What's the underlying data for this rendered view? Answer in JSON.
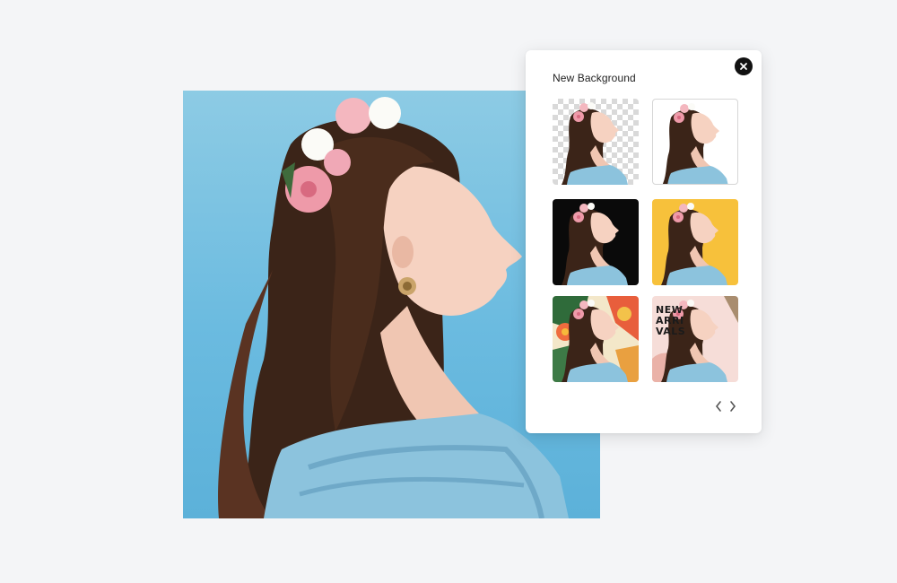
{
  "panel": {
    "title": "New Background",
    "close_icon": "close-icon",
    "backgrounds": [
      {
        "id": "transparent",
        "label": ""
      },
      {
        "id": "white",
        "label": ""
      },
      {
        "id": "black",
        "label": ""
      },
      {
        "id": "yellow",
        "label": ""
      },
      {
        "id": "floral",
        "label": ""
      },
      {
        "id": "new-arrivals",
        "label": "NEW\nARRI\nVALS"
      }
    ],
    "pager": {
      "prev_icon": "chevron-left-icon",
      "next_icon": "chevron-right-icon"
    }
  },
  "colors": {
    "photo_background": "#6bbbe0",
    "yellow_background": "#f7c13b",
    "black_background": "#0a0a0a",
    "dress": "#8cc3dd",
    "hair": "#3b2418"
  }
}
